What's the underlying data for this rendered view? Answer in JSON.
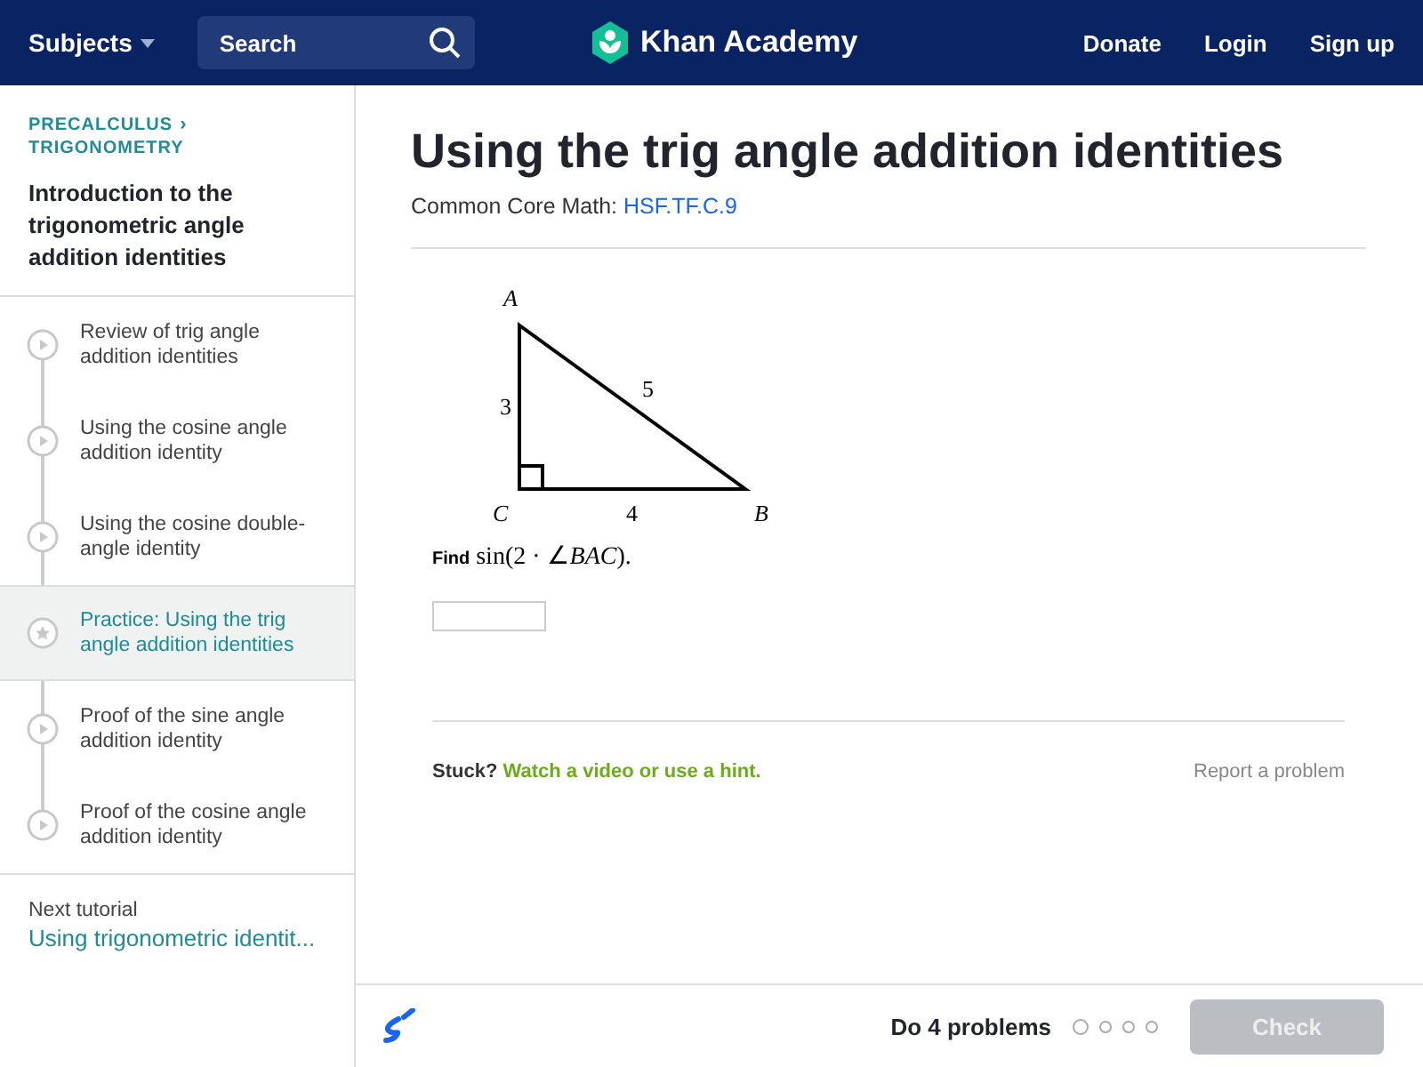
{
  "header": {
    "subjects": "Subjects",
    "search": {
      "placeholder": "Search"
    },
    "logo": "Khan Academy",
    "links": [
      "Donate",
      "Login",
      "Sign up"
    ]
  },
  "sidebar": {
    "breadcrumb": [
      "PRECALCULUS",
      "TRIGONOMETRY"
    ],
    "breadcrumb_separator": "›",
    "title": "Introduction to the trigonometric angle addition identities",
    "items": [
      {
        "kind": "video",
        "label": "Review of trig angle addition identities",
        "selected": false
      },
      {
        "kind": "video",
        "label": "Using the cosine angle addition identity",
        "selected": false
      },
      {
        "kind": "video",
        "label": "Using the cosine double-angle identity",
        "selected": false
      },
      {
        "kind": "practice",
        "label": "Practice: Using the trig angle addition identities",
        "selected": true
      },
      {
        "kind": "video",
        "label": "Proof of the sine angle addition identity",
        "selected": false
      },
      {
        "kind": "video",
        "label": "Proof of the cosine angle addition identity",
        "selected": false
      }
    ],
    "next_label": "Next tutorial",
    "next_link": "Using trigonometric identit..."
  },
  "main": {
    "title": "Using the trig angle addition identities",
    "standard_label": "Common Core Math:",
    "standard_link": "HSF.TF.C.9",
    "figure": {
      "vertex_a": "A",
      "vertex_b": "B",
      "vertex_c": "C",
      "side_ac": "3",
      "side_cb": "4",
      "side_ab": "5"
    },
    "question": "**Find** sin(2 · ∠*BAC*).",
    "stuck": "Stuck?",
    "hint_link": "Watch a video or use a hint.",
    "report": "Report a problem"
  },
  "footer": {
    "goal": "Do 4 problems",
    "dots": [
      {
        "current": true
      },
      {
        "current": false
      },
      {
        "current": false
      },
      {
        "current": false
      }
    ],
    "check": {
      "label": "Check",
      "disabled": true
    }
  }
}
